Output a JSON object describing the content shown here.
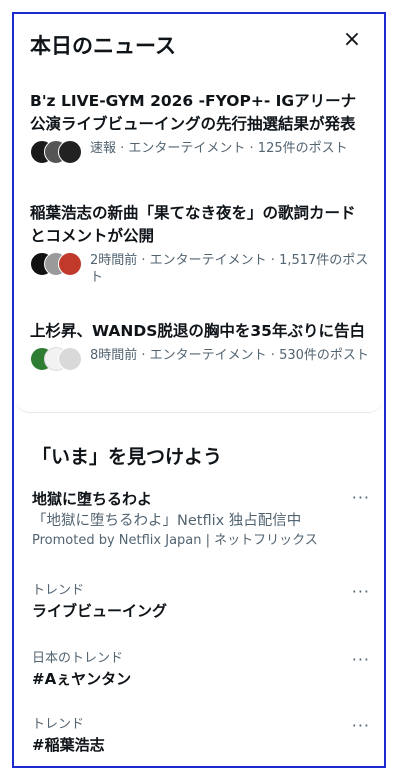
{
  "header": {
    "title": "本日のニュース",
    "close_label": "×"
  },
  "news": [
    {
      "title": "B'z LIVE-GYM 2026 -FYOP+- IGアリーナ公演ライブビューイングの先行抽選結果が発表",
      "meta": "速報 · エンターテイメント · 125件のポスト",
      "avatars": [
        "#1a1a1a",
        "#555555",
        "#222222"
      ]
    },
    {
      "title": "稲葉浩志の新曲「果てなき夜を」の歌詞カードとコメントが公開",
      "meta": "2時間前 · エンターテイメント · 1,517件のポスト",
      "avatars": [
        "#111111",
        "#9a9a9a",
        "#c0392b"
      ]
    },
    {
      "title": "上杉昇、WANDS脱退の胸中を35年ぶりに告白",
      "meta": "8時間前 · エンターテイメント · 530件のポスト",
      "avatars": [
        "#2e7d32",
        "#f2f2f2",
        "#d9d9d9"
      ]
    }
  ],
  "discover": {
    "title": "「いま」を見つけよう",
    "more_label": "···",
    "promoted": {
      "name": "地獄に堕ちるわよ",
      "desc": "「地獄に堕ちるわよ」Netflix 独占配信中",
      "by": "Promoted by Netflix Japan | ネットフリックス"
    },
    "trends": [
      {
        "category": "トレンド",
        "name": "ライブビューイング"
      },
      {
        "category": "日本のトレンド",
        "name": "#Aぇヤンタン"
      },
      {
        "category": "トレンド",
        "name": "#稲葉浩志"
      }
    ]
  }
}
